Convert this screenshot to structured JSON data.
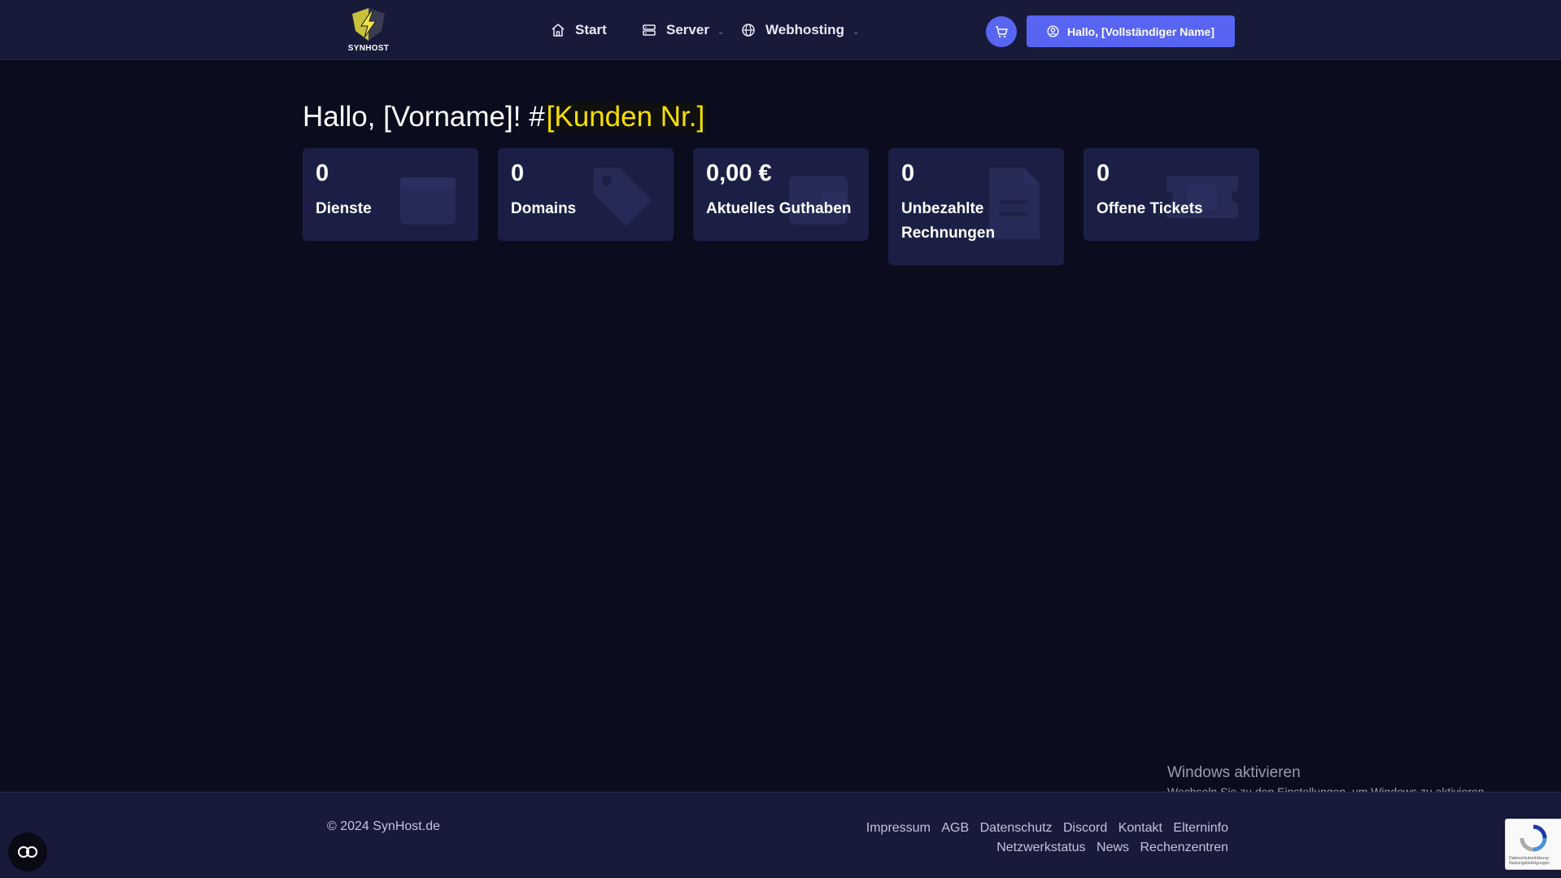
{
  "header": {
    "logo_text": "SYNHOST",
    "nav": [
      {
        "label": "Start",
        "icon": "home-icon"
      },
      {
        "label": "Server",
        "icon": "server-icon",
        "has_dropdown": true
      },
      {
        "label": "Webhosting",
        "icon": "globe-icon",
        "has_dropdown": true
      }
    ],
    "cart_icon": "cart-icon",
    "user_button_label": "Hallo, [Vollständiger Name]",
    "user_button_icon": "user-icon"
  },
  "main": {
    "greeting_prefix": "Hallo, [Vorname]! #",
    "customer_number": "[Kunden Nr.]",
    "cards": [
      {
        "value": "0",
        "label": "Dienste",
        "icon": "box-icon"
      },
      {
        "value": "0",
        "label": "Domains",
        "icon": "tag-icon"
      },
      {
        "value": "0,00 €",
        "label": "Aktuelles Guthaben",
        "icon": "wallet-icon"
      },
      {
        "value": "0",
        "label": "Unbezahlte Rechnungen",
        "icon": "invoice-icon"
      },
      {
        "value": "0",
        "label": "Offene Tickets",
        "icon": "ticket-icon"
      }
    ]
  },
  "footer": {
    "copyright": "© 2024 SynHost.de",
    "links_row1": [
      "Impressum",
      "AGB",
      "Datenschutz",
      "Discord",
      "Kontakt",
      "Elterninfo"
    ],
    "links_row2": [
      "Netzwerkstatus",
      "News",
      "Rechenzentren"
    ]
  },
  "overlay": {
    "windows_title": "Windows aktivieren",
    "windows_subtitle": "Wechseln Sie zu den Einstellungen, um Windows zu aktivieren.",
    "recaptcha_text": "Datenschutzerklärung - Nutzungsbedingungen"
  },
  "colors": {
    "background": "#0b0c1e",
    "header": "#181a3a",
    "card": "#1c1f45",
    "accent": "#5865f2",
    "highlight": "#f5e000"
  }
}
